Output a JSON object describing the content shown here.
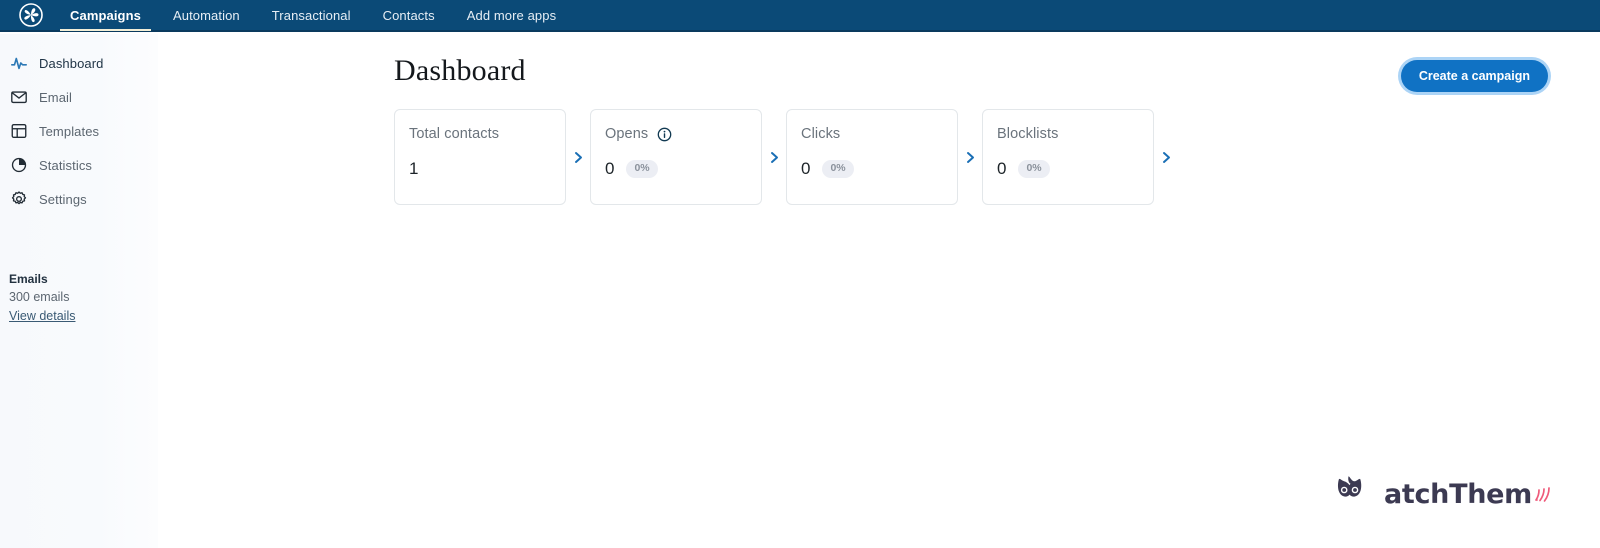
{
  "topnav": {
    "logo_name": "brevo-spiral-logo",
    "background_color": "#0b4a77",
    "active_underline_color": "#f2efd8",
    "items": [
      {
        "label": "Campaigns",
        "active": true
      },
      {
        "label": "Automation",
        "active": false
      },
      {
        "label": "Transactional",
        "active": false
      },
      {
        "label": "Contacts",
        "active": false
      },
      {
        "label": "Add more apps",
        "active": false
      }
    ]
  },
  "sidebar": {
    "items": [
      {
        "label": "Dashboard",
        "icon": "activity-pulse-icon",
        "active": true
      },
      {
        "label": "Email",
        "icon": "envelope-icon",
        "active": false
      },
      {
        "label": "Templates",
        "icon": "layout-template-icon",
        "active": false
      },
      {
        "label": "Statistics",
        "icon": "pie-chart-icon",
        "active": false
      },
      {
        "label": "Settings",
        "icon": "gear-icon",
        "active": false
      }
    ],
    "usage": {
      "title": "Emails",
      "count": "300 emails",
      "link": "View details"
    }
  },
  "main": {
    "page_title": "Dashboard",
    "cta_label": "Create a campaign",
    "cta_color": "#1072c4",
    "stats": [
      {
        "label": "Total contacts",
        "value": "1",
        "badge": null,
        "has_info": false
      },
      {
        "label": "Opens",
        "value": "0",
        "badge": "0%",
        "has_info": true
      },
      {
        "label": "Clicks",
        "value": "0",
        "badge": "0%",
        "has_info": false
      },
      {
        "label": "Blocklists",
        "value": "0",
        "badge": "0%",
        "has_info": false
      }
    ]
  },
  "watermark": {
    "text": "atchThem",
    "full_name": "WatchThem",
    "text_color": "#3c3a52",
    "accent_color": "#ef5b7b"
  }
}
